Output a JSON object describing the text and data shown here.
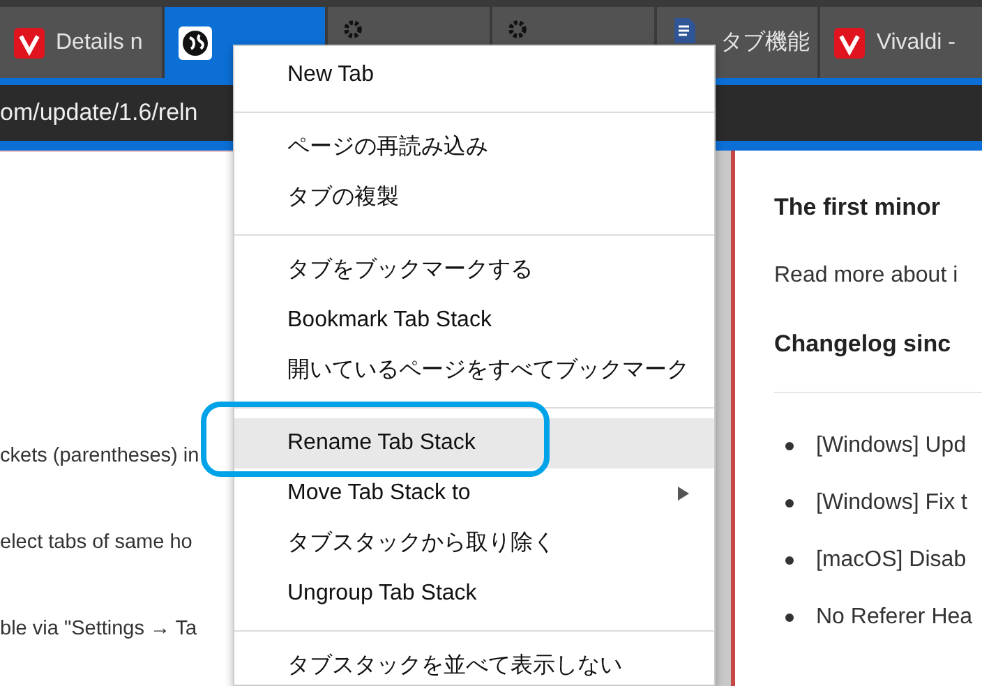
{
  "tabs": [
    {
      "title": "Details n",
      "selected": false
    },
    {
      "selected": true
    },
    {
      "selected": false
    },
    {
      "selected": false
    },
    {
      "title": "タブ機能",
      "selected": false
    },
    {
      "title": "Vivaldi -",
      "selected": false
    }
  ],
  "address_bar": {
    "value": "om/update/1.6/reln"
  },
  "left_pane": {
    "lines": [
      "ckets (parentheses) in",
      "elect tabs of same ho",
      "ble via \"Settings → Ta"
    ]
  },
  "right_pane": {
    "heading": "The first minor",
    "intro": "Read more about i",
    "subheading": "Changelog sinc",
    "items": [
      "[Windows] Upd",
      "[Windows] Fix t",
      "[macOS] Disab",
      "No Referer Hea"
    ]
  },
  "context_menu": {
    "items": [
      {
        "kind": "item",
        "label": "New Tab",
        "highlighted": false
      },
      {
        "kind": "separator"
      },
      {
        "kind": "item",
        "label": "ページの再読み込み",
        "highlighted": false
      },
      {
        "kind": "item",
        "label": "タブの複製",
        "highlighted": false
      },
      {
        "kind": "separator"
      },
      {
        "kind": "item",
        "label": "タブをブックマークする",
        "highlighted": false
      },
      {
        "kind": "item",
        "label": "Bookmark Tab Stack",
        "highlighted": false
      },
      {
        "kind": "item",
        "label": "開いているページをすべてブックマーク",
        "highlighted": false
      },
      {
        "kind": "separator"
      },
      {
        "kind": "item",
        "label": "Rename Tab Stack",
        "highlighted": true,
        "annotated": true
      },
      {
        "kind": "submenu",
        "label": "Move Tab Stack to",
        "highlighted": false
      },
      {
        "kind": "item",
        "label": "タブスタックから取り除く",
        "highlighted": false
      },
      {
        "kind": "item",
        "label": "Ungroup Tab Stack",
        "highlighted": false
      },
      {
        "kind": "separator"
      },
      {
        "kind": "item",
        "label": "タブスタックを並べて表示しない",
        "highlighted": false
      }
    ]
  }
}
